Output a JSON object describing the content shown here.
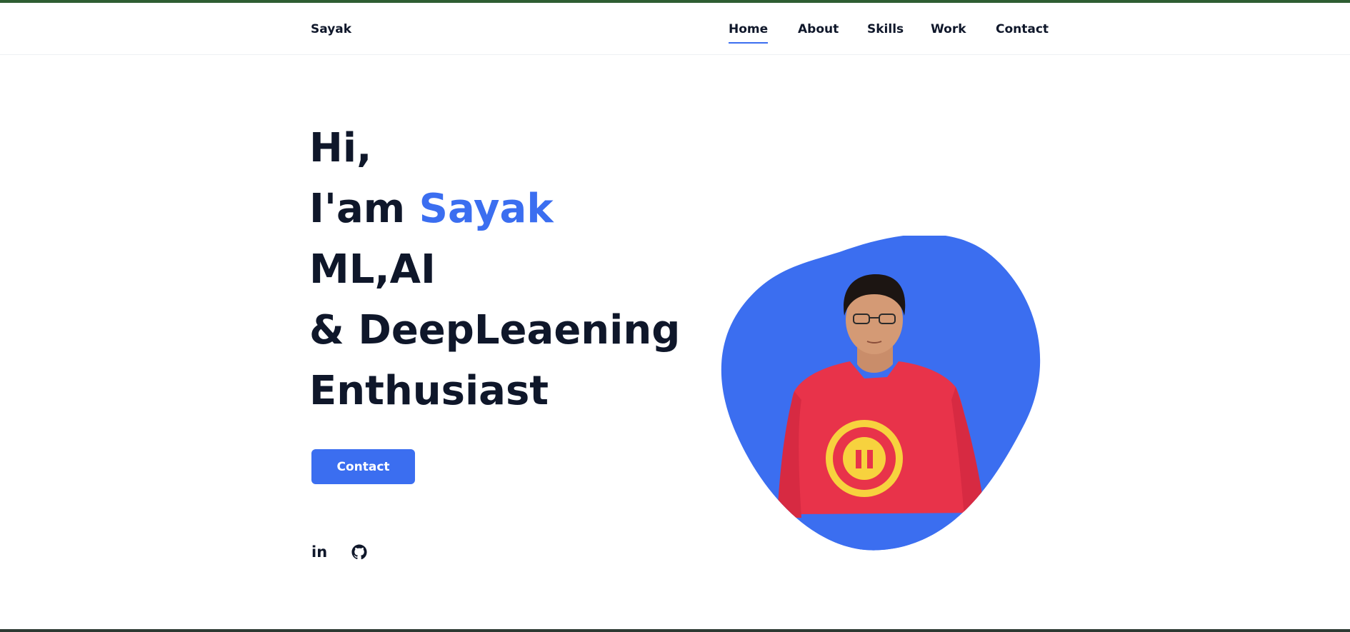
{
  "header": {
    "logo": "Sayak",
    "nav": [
      {
        "label": "Home",
        "active": true
      },
      {
        "label": "About",
        "active": false
      },
      {
        "label": "Skills",
        "active": false
      },
      {
        "label": "Work",
        "active": false
      },
      {
        "label": "Contact",
        "active": false
      }
    ]
  },
  "hero": {
    "line1": "Hi,",
    "line2_prefix": "I'am ",
    "line2_name": "Sayak",
    "line3": "ML,AI",
    "line4": "& DeepLeaening",
    "line5": "Enthusiast",
    "button_label": "Contact",
    "socials": [
      {
        "name": "linkedin",
        "label": "in"
      },
      {
        "name": "github",
        "icon": "github-icon"
      }
    ]
  },
  "colors": {
    "accent": "#3b6ef0",
    "text": "#0f172a",
    "shirt": "#e8334a",
    "logo_badge": "#f7d23e"
  }
}
